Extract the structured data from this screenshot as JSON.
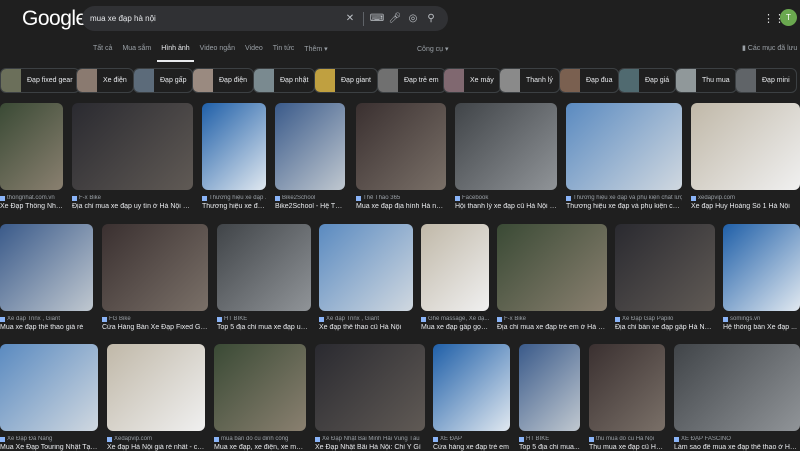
{
  "header": {
    "logo": "Google",
    "query": "mua xe đạp hà nội",
    "avatar": "T",
    "apps_icon": "apps-grid-icon"
  },
  "tabs": [
    "Tất cả",
    "Mua sắm",
    "Hình ảnh",
    "Video ngắn",
    "Video",
    "Tin tức",
    "Thêm ▾"
  ],
  "tools": "Công cụ ▾",
  "saved": "Các mục đã lưu",
  "chips": [
    "Đạp fixed gear",
    "Xe điện",
    "Đạp gấp",
    "Đạp điện",
    "Đạp nhật",
    "Đạp giant",
    "Đạp trẻ em",
    "Xe máy",
    "Thanh lý",
    "Đạp đua",
    "Đạp giá",
    "Thu mua",
    "Đạp mini"
  ],
  "results": [
    [
      {
        "src": "thongnhat.com.vn",
        "title": "Xe Đạp Thống Nhất..."
      },
      {
        "src": "F-x Bike",
        "title": "Địa chỉ mua xe đạp uy tín ở Hà Nội giá t..."
      },
      {
        "src": "Thương hiệu xe đạp ...",
        "title": "Thương hiệu xe đạ..."
      },
      {
        "src": "Bike2School",
        "title": "Bike2School - Hệ Thố..."
      },
      {
        "src": "Thể Thao 365",
        "title": "Mua xe đạp địa hình Hà nội c..."
      },
      {
        "src": "Facebook",
        "title": "Hội thanh lý xe đạp cũ Hà Nội | Fa..."
      },
      {
        "src": "Thương hiệu xe đạp và phụ kiện chất lượ...",
        "title": "Thương hiệu xe đạp và phụ kiện chất l..."
      },
      {
        "src": "xedapvip.com",
        "title": "Xe đạp Huy Hoàng Số 1 Hà Nội"
      }
    ],
    [
      {
        "src": "Xe đạp Trinx , Giant",
        "title": "Mua xe đạp thể thao giá rẻ"
      },
      {
        "src": "FG Bike",
        "title": "Cửa Hàng Bán Xe Đạp Fixed Gear ..."
      },
      {
        "src": "HT BIKE",
        "title": "Top 5 địa chỉ mua xe đạp uy tí..."
      },
      {
        "src": "Xe đạp Trinx , Giant",
        "title": "Xe đạp thể thao cũ Hà Nội"
      },
      {
        "src": "Ghế massage, Xe đạ...",
        "title": "Mua xe đạp gấp gọn ..."
      },
      {
        "src": "F-x Bike",
        "title": "Địa chỉ mua xe đạp trẻ em ở Hà Nội ..."
      },
      {
        "src": "Xe Đạp Gấp Papilo",
        "title": "Địa chỉ bán xe đạp gấp Hà Nội \"..."
      },
      {
        "src": "somings.vn",
        "title": "Hệ thống bán Xe đạp ..."
      }
    ],
    [
      {
        "src": "Xe Đạp Đà Nẵng",
        "title": "Mua Xe Đạp Touring Nhật Tại H..."
      },
      {
        "src": "Xedapvip.com",
        "title": "Xe đạp Hà Nội giá rẻ nhất - chín..."
      },
      {
        "src": "mua bán đồ cũ đinh công",
        "title": "Mua xe đạp, xe điện, xe máy cũ..."
      },
      {
        "src": "Xe Đạp Nhật Bãi Minh Hải Vũng Tàu",
        "title": "Xe Đạp Nhật Bãi Hà Nội: Chỉ Ý Gì"
      },
      {
        "src": "XE ĐẠP",
        "title": "Cửa hàng xe đạp trẻ em"
      },
      {
        "src": "HT BIKE",
        "title": "Top 5 địa chỉ mua..."
      },
      {
        "src": "thu mua đồ cũ Hà Nội",
        "title": "Thu mua xe đạp cũ Hà..."
      },
      {
        "src": "XE ĐẠP FASCINO",
        "title": "Làm sao để mua xe đạp thể thao ở Hà N..."
      }
    ]
  ]
}
